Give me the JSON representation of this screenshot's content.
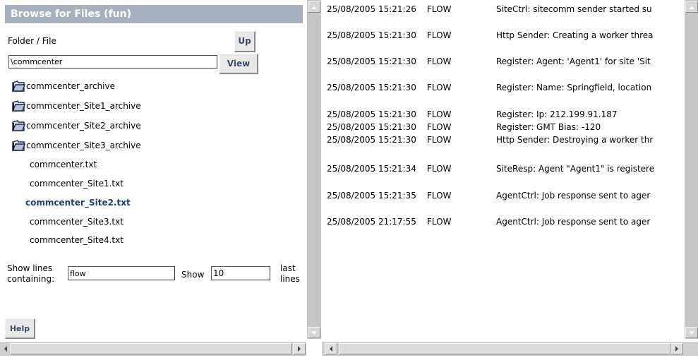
{
  "left": {
    "title": "Browse for Files (fun)",
    "folder_file_label": "Folder / File",
    "up_label": "Up",
    "path_value": "\\commcenter",
    "view_label": "View",
    "folders": [
      "commcenter_archive",
      "commcenter_Site1_archive",
      "commcenter_Site2_archive",
      "commcenter_Site3_archive"
    ],
    "files": [
      "commcenter.txt",
      "commcenter_Site1.txt",
      "commcenter_Site2.txt",
      "commcenter_Site3.txt",
      "commcenter_Site4.txt"
    ],
    "selected_file_index": 2,
    "filter": {
      "show_lines_label": "Show lines",
      "containing_label": "containing:",
      "filter_value": "flow",
      "show_label": "Show",
      "count_value": "10",
      "last_label": "last",
      "lines_label": "lines"
    },
    "help_label": "Help"
  },
  "log": {
    "rows": [
      {
        "ts": "25/08/2005 15:21:26",
        "level": "FLOW",
        "msg": "SiteCtrl: sitecomm sender started su"
      },
      {
        "ts": "25/08/2005 15:21:30",
        "level": "FLOW",
        "msg": "Http Sender: Creating a worker threa"
      },
      {
        "ts": "25/08/2005 15:21:30",
        "level": "FLOW",
        "msg": "Register: Agent: 'Agent1' for site 'Sit"
      },
      {
        "ts": "25/08/2005 15:21:30",
        "level": "FLOW",
        "msg": "Register: Name: Springfield, location"
      },
      {
        "ts": "25/08/2005 15:21:30",
        "level": "FLOW",
        "msg": "Register: Ip: 212.199.91.187"
      },
      {
        "ts": "25/08/2005 15:21:30",
        "level": "FLOW",
        "msg": "Register: GMT Bias: -120"
      },
      {
        "ts": "25/08/2005 15:21:30",
        "level": "FLOW",
        "msg": "Http Sender: Destroying a worker thr"
      },
      {
        "ts": "25/08/2005 15:21:34",
        "level": "FLOW",
        "msg": "SiteResp: Agent \"Agent1\" is registere"
      },
      {
        "ts": "25/08/2005 15:21:35",
        "level": "FLOW",
        "msg": "AgentCtrl: Job response sent to ager"
      },
      {
        "ts": "25/08/2005 21:17:55",
        "level": "FLOW",
        "msg": "AgentCtrl: Job response sent to ager"
      }
    ]
  },
  "colors": {
    "title_bar": "#a8b0bf",
    "selected_file": "#1f3c7a",
    "scroll_track": "#c6c6c6"
  }
}
